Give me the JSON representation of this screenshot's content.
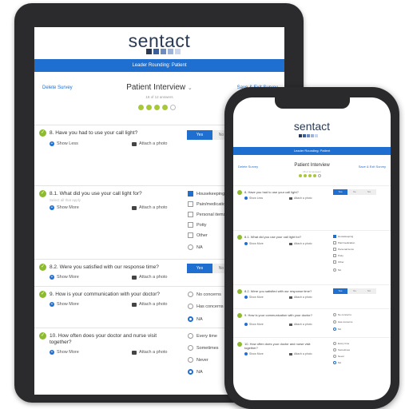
{
  "brand": {
    "logo_text": "sentact",
    "bar_text": "Leader Rounding: Patient"
  },
  "nav": {
    "left": "Delete Survey",
    "title": "Patient Interview",
    "right": "Save & Exit Survey",
    "progress": "18 of 12 answers"
  },
  "tablet_questions": [
    {
      "text": "8. Have you had to use your call light?",
      "more": "Show Less",
      "attach": "Attach a photo",
      "yes": "Yes",
      "no": "No"
    },
    {
      "text": "8.1. What did you use your call light for?",
      "hint": "Select all that apply",
      "more": "Show More",
      "attach": "Attach a photo",
      "options": [
        "Housekeeping",
        "Pain/medication",
        "Personal items",
        "Potty",
        "Other",
        "NA"
      ]
    },
    {
      "text": "8.2. Were you satisfied with our response time?",
      "more": "Show More",
      "attach": "Attach a photo",
      "yes": "Yes",
      "no": "No"
    },
    {
      "text": "9. How is your communication with your doctor?",
      "more": "Show More",
      "attach": "Attach a photo",
      "options": [
        "No concerns",
        "Has concerns",
        "NA"
      ]
    },
    {
      "text": "10. How often does your doctor and nurse visit together?",
      "more": "Show More",
      "attach": "Attach a photo",
      "options": [
        "Every time",
        "Sometimes",
        "Never",
        "NA"
      ]
    }
  ],
  "phone_questions": [
    {
      "text": "8. Have you had to use your call light?",
      "more": "Show Less",
      "attach": "Attach a photo",
      "yes": "Yes",
      "no": "No",
      "na": "NA"
    },
    {
      "text": "8.1. What did you use your call light for?",
      "more": "Show More",
      "attach": "Attach a photo",
      "options": [
        "Housekeeping",
        "Pain/medication",
        "Personal items",
        "Potty",
        "Other",
        "NA"
      ]
    },
    {
      "text": "8.2. Were you satisfied with our response time?",
      "more": "Show More",
      "attach": "Attach a photo",
      "yes": "Yes",
      "no": "No",
      "na": "NA"
    },
    {
      "text": "9. How is your communication with your doctor?",
      "more": "Show More",
      "attach": "Attach a photo",
      "options": [
        "No concerns",
        "Has concerns",
        "NA"
      ]
    },
    {
      "text": "10. How often does your doctor and nurse visit together?",
      "more": "Show More",
      "attach": "Attach a photo",
      "options": [
        "Every time",
        "Sometimes",
        "Never",
        "NA"
      ]
    }
  ],
  "colors": {
    "brand_blue": "#1f6fd0",
    "check_green": "#8dbb2e",
    "logo_navy": "#2a3a55"
  },
  "icons": {
    "check": "check-circle-icon",
    "plus": "plus-circle-icon",
    "camera": "camera-icon",
    "chevron": "chevron-down-icon"
  }
}
